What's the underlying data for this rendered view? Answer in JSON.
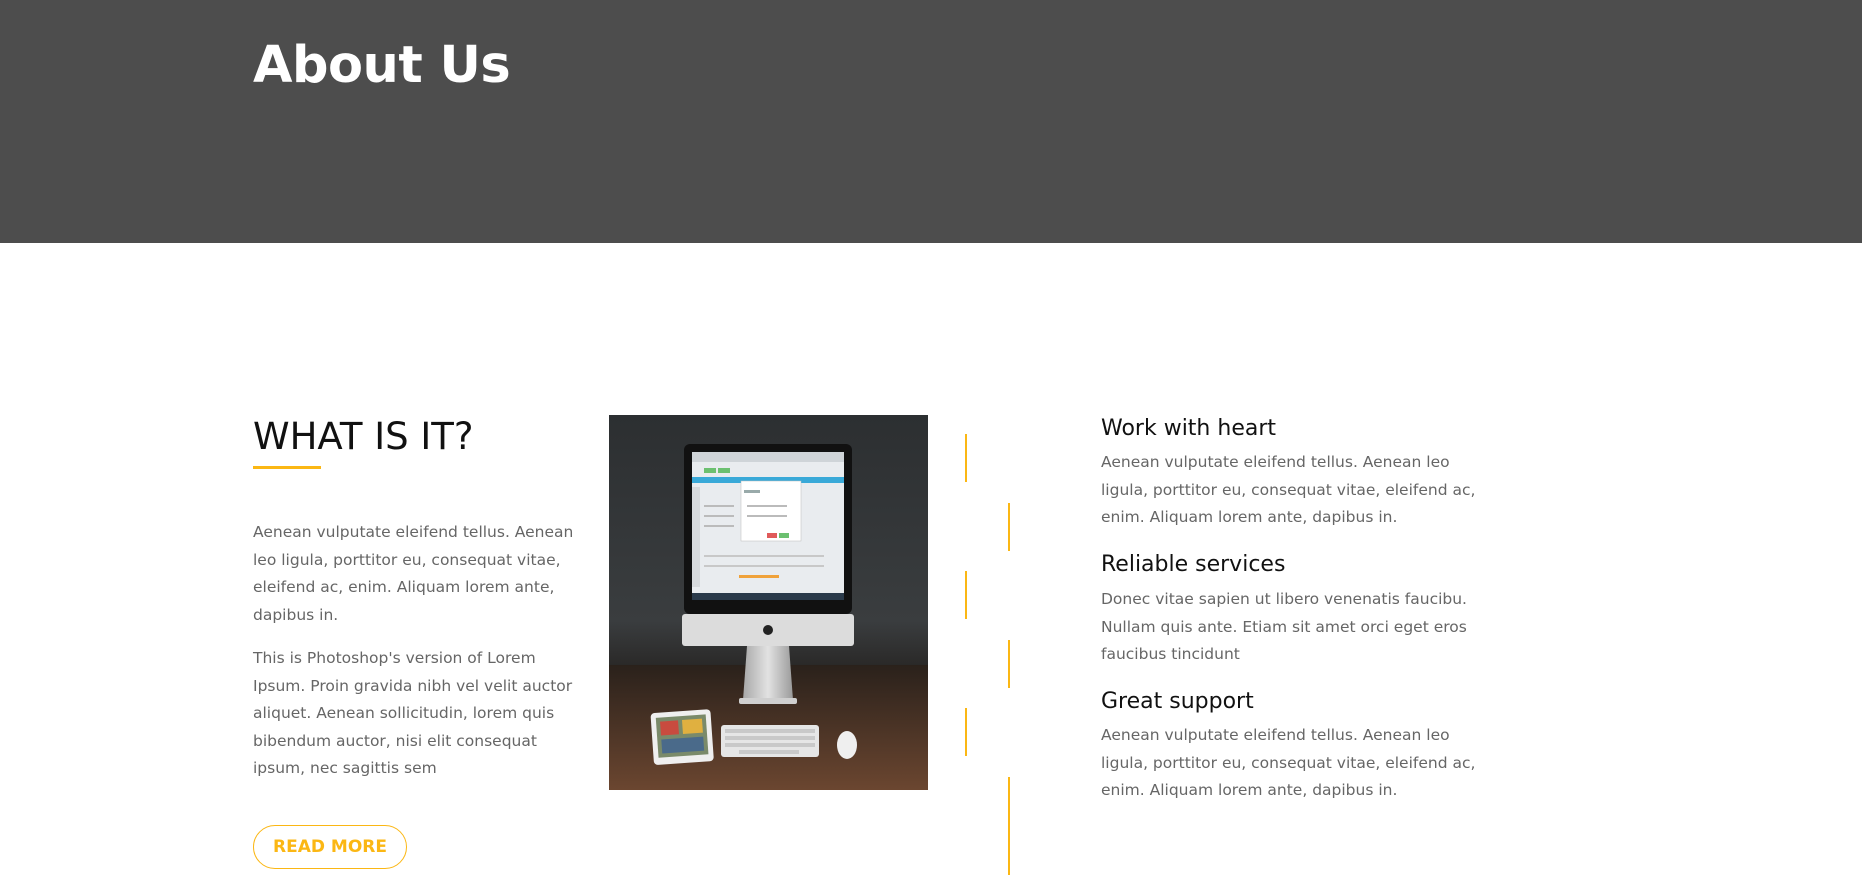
{
  "header": {
    "title": "About Us",
    "background_color": "#4d4d4d"
  },
  "about": {
    "title": "WHAT IS IT?",
    "accent_color": "#fbb714",
    "paragraph_1": "Aenean vulputate eleifend tellus. Aenean leo ligula, porttitor eu, consequat vitae, eleifend ac, enim. Aliquam lorem ante, dapibus in.",
    "paragraph_2": "This is Photoshop's version of Lorem Ipsum. Proin gravida nibh vel velit auctor aliquet. Aenean sollicitudin, lorem quis bibendum auctor, nisi elit consequat ipsum, nec sagittis sem",
    "button_label": "READ MORE",
    "image": "desktop-computer-photo"
  },
  "features": [
    {
      "title": "Work with heart",
      "text": "Aenean vulputate eleifend tellus. Aenean leo ligula, porttitor eu, consequat vitae, eleifend ac, enim. Aliquam lorem ante, dapibus in."
    },
    {
      "title": "Reliable services",
      "text": "Donec vitae sapien ut libero venenatis faucibu. Nullam quis ante. Etiam sit amet orci eget eros faucibus tincidunt"
    },
    {
      "title": "Great support",
      "text": "Aenean vulputate eleifend tellus. Aenean leo ligula, porttitor eu, consequat vitae, eleifend ac, enim. Aliquam lorem ante, dapibus in."
    }
  ]
}
